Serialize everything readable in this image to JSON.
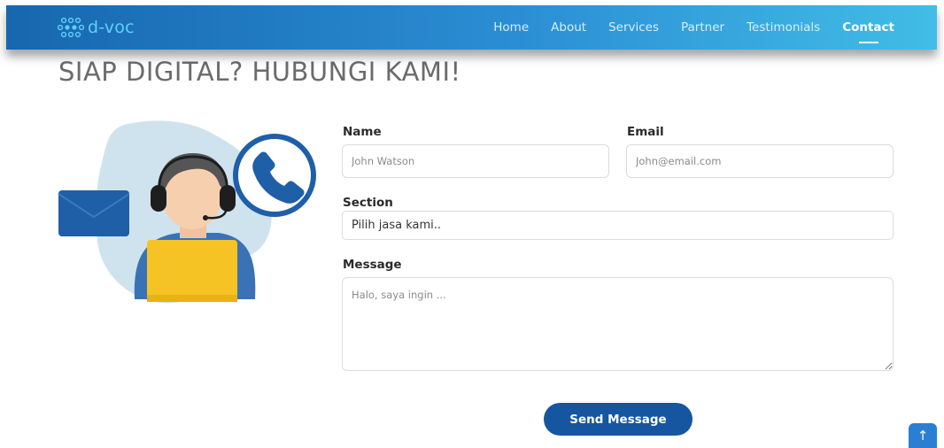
{
  "brand": {
    "name": "d-voc",
    "color": "#5fd0ff"
  },
  "nav": {
    "links": [
      "Home",
      "About",
      "Services",
      "Partner",
      "Testimonials",
      "Contact"
    ],
    "active": "Contact"
  },
  "page": {
    "title": "SIAP DIGITAL? HUBUNGI KAMI!"
  },
  "form": {
    "name_label": "Name",
    "name_placeholder": "John Watson",
    "email_label": "Email",
    "email_placeholder": "John@email.com",
    "section_label": "Section",
    "section_value": "Pilih jasa kami..",
    "message_label": "Message",
    "message_placeholder": "Halo, saya ingin ...",
    "submit_label": "Send Message"
  },
  "back_to_top": {
    "icon": "arrow-up-icon",
    "glyph": "↑"
  },
  "colors": {
    "navbar_start": "#1767ae",
    "navbar_end": "#41bde6",
    "button": "#1655a0",
    "illustration_blue": "#1f5fa8",
    "illustration_yellow": "#f6c324"
  }
}
